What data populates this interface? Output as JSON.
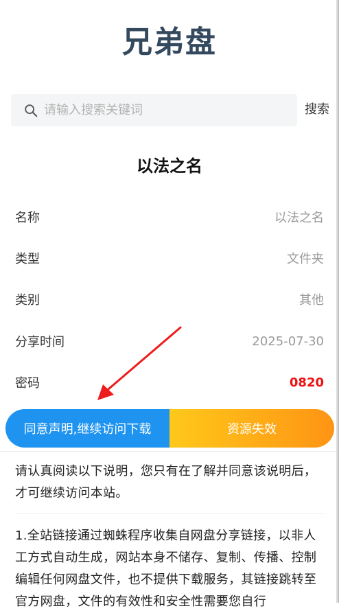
{
  "site_title": "兄弟盘",
  "search": {
    "placeholder": "请输入搜索关键词",
    "button_label": "搜索"
  },
  "resource_title": "以法之名",
  "info": [
    {
      "label": "名称",
      "value": "以法之名"
    },
    {
      "label": "类型",
      "value": "文件夹"
    },
    {
      "label": "类别",
      "value": "其他"
    },
    {
      "label": "分享时间",
      "value": "2025-07-30"
    },
    {
      "label": "密码",
      "value": "0820"
    }
  ],
  "actions": {
    "agree_label": "同意声明,继续访问下载",
    "invalid_label": "资源失效"
  },
  "notice": {
    "intro": "请认真阅读以下说明，您只有在了解并同意该说明后，才可继续访问本站。",
    "item1": "1.全站链接通过蜘蛛程序收集自网盘分享链接，以非人工方式自动生成，网站本身不储存、复制、传播、控制编辑任何网盘文件，也不提供下载服务，其链接跳转至官方网盘，文件的有效性和安全性需要您自行"
  },
  "colors": {
    "title": "#34495e",
    "primary_blue": "#1e93f0",
    "gold_start": "#ffc81a",
    "gold_end": "#ff9414",
    "password_red": "#ee1111"
  }
}
